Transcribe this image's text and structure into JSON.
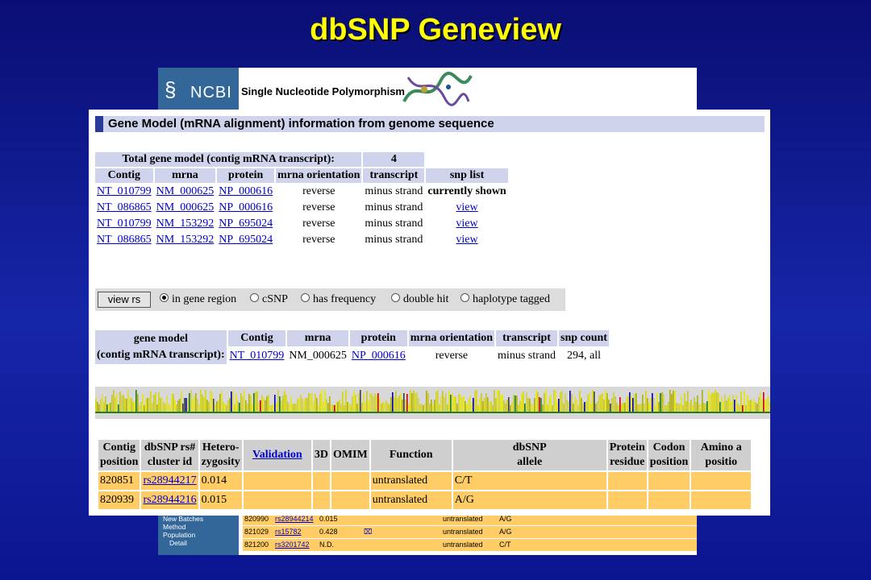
{
  "slide": {
    "title": "dbSNP Geneview"
  },
  "back_window": {
    "logo": "NCBI",
    "header_title": "Single Nucleotide Polymorphism",
    "nav_items": [
      "New Batches",
      "Method",
      "Population",
      "Detail"
    ],
    "rows": [
      {
        "pos": "820990",
        "rs": "rs28944214",
        "het": "0.015",
        "func": "untranslated",
        "allele": "A/G"
      },
      {
        "pos": "821029",
        "rs": "rs15782",
        "het": "0.428",
        "func": "untranslated",
        "allele": "A/G"
      },
      {
        "pos": "821200",
        "rs": "rs3201742",
        "het": "N.D.",
        "func": "untranslated",
        "allele": "C/T"
      }
    ]
  },
  "front_window": {
    "section_title": "Gene Model (mRNA alignment) information from genome sequence",
    "gene_models": {
      "total_label": "Total gene model (contig mRNA transcript):",
      "total_value": "4",
      "headers": [
        "Contig",
        "mrna",
        "protein",
        "mrna orientation",
        "transcript",
        "snp list"
      ],
      "rows": [
        {
          "contig": "NT_010799",
          "mrna": "NM_000625",
          "protein": "NP_000616",
          "orientation": "reverse",
          "transcript": "minus strand",
          "snp": "currently shown"
        },
        {
          "contig": "NT_086865",
          "mrna": "NM_000625",
          "protein": "NP_000616",
          "orientation": "reverse",
          "transcript": "minus strand",
          "snp": "view"
        },
        {
          "contig": "NT_010799",
          "mrna": "NM_153292",
          "protein": "NP_695024",
          "orientation": "reverse",
          "transcript": "minus strand",
          "snp": "view"
        },
        {
          "contig": "NT_086865",
          "mrna": "NM_153292",
          "protein": "NP_695024",
          "orientation": "reverse",
          "transcript": "minus strand",
          "snp": "view"
        }
      ]
    },
    "filter": {
      "button": "view rs",
      "options": [
        "in gene region",
        "cSNP",
        "has frequency",
        "double hit",
        "haplotype tagged"
      ],
      "selected": "in gene region"
    },
    "current_model": {
      "label_line1": "gene model",
      "label_line2": "(contig mRNA transcript):",
      "headers": [
        "Contig",
        "mrna",
        "protein",
        "mrna orientation",
        "transcript",
        "snp count"
      ],
      "contig": "NT_010799",
      "mrna": "NM_000625",
      "protein": "NP_000616",
      "orientation": "reverse",
      "transcript": "minus strand",
      "snp_count": "294, all"
    },
    "snp_table": {
      "headers": [
        {
          "l1": "Contig",
          "l2": "position"
        },
        {
          "l1": "dbSNP rs#",
          "l2": "cluster id"
        },
        {
          "l1": "Hetero-",
          "l2": "zygosity"
        },
        {
          "l1": "Validation",
          "l2": ""
        },
        {
          "l1": "3D",
          "l2": ""
        },
        {
          "l1": "OMIM",
          "l2": ""
        },
        {
          "l1": "Function",
          "l2": ""
        },
        {
          "l1": "dbSNP",
          "l2": "allele"
        },
        {
          "l1": "Protein",
          "l2": "residue"
        },
        {
          "l1": "Codon",
          "l2": "position"
        },
        {
          "l1": "Amino a",
          "l2": "positio"
        }
      ],
      "rows": [
        {
          "pos": "820851",
          "rs": "rs28944217",
          "het": "0.014",
          "func": "untranslated",
          "allele": "C/T"
        },
        {
          "pos": "820939",
          "rs": "rs28944216",
          "het": "0.015",
          "func": "untranslated",
          "allele": "A/G"
        }
      ]
    }
  }
}
